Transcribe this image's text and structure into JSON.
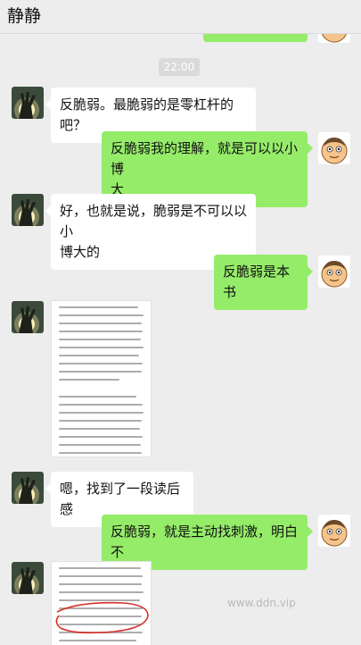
{
  "header": {
    "title": "静静"
  },
  "timestamp": "22:00",
  "messages": [
    {
      "side": "left",
      "text": "反脆弱。最脆弱的是零杠杆的吧？"
    },
    {
      "side": "right",
      "line1": "反脆弱我的理解，就是可以以小博",
      "line2": "大"
    },
    {
      "side": "left",
      "line1": "好，也就是说，脆弱是不可以以小",
      "line2": "博大的"
    },
    {
      "side": "right",
      "text": "反脆弱是本书"
    },
    {
      "side": "left",
      "type": "image",
      "icon": "document-photo-icon"
    },
    {
      "side": "left",
      "text": "嗯，找到了一段读后感"
    },
    {
      "side": "right",
      "text": "反脆弱，就是主动找刺激，明白不"
    },
    {
      "side": "left",
      "type": "image",
      "icon": "document-photo-icon"
    }
  ],
  "watermark": "www.ddn.vip",
  "colors": {
    "background": "#ededed",
    "sent_bubble": "#95ec69",
    "received_bubble": "#ffffff",
    "annotation": "#d9302c"
  }
}
